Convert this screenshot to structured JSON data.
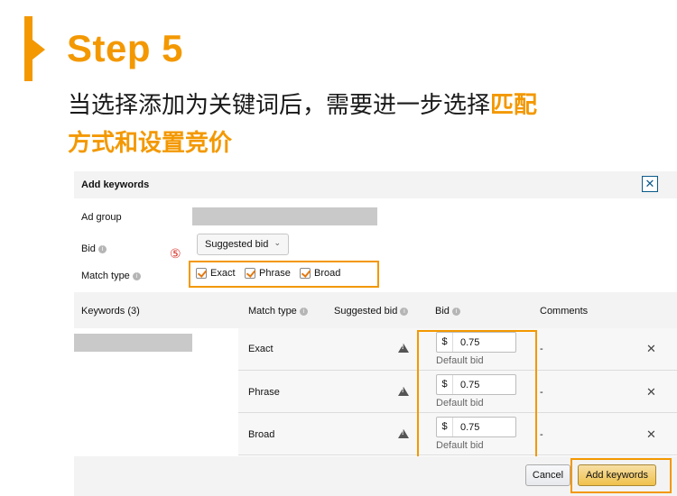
{
  "header": {
    "step_title": "Step 5",
    "desc_line1": "当选择添加为关键词后，需要进一步选择",
    "desc_highlight1": "匹配",
    "desc_highlight2": "方式和设置竞价"
  },
  "dialog": {
    "title": "Add keywords",
    "close_label": "✕",
    "ad_group_label": "Ad group",
    "bid_label": "Bid",
    "bid_select_value": "Suggested bid",
    "match_type_label": "Match type",
    "step_marker": "⑤",
    "match_options": [
      {
        "label": "Exact",
        "checked": true
      },
      {
        "label": "Phrase",
        "checked": true
      },
      {
        "label": "Broad",
        "checked": true
      }
    ],
    "table": {
      "headers": {
        "keywords": "Keywords (3)",
        "match_type": "Match type",
        "suggested_bid": "Suggested bid",
        "bid": "Bid",
        "comments": "Comments"
      },
      "rows": [
        {
          "match_type": "Exact",
          "currency": "$",
          "bid": "0.75",
          "default_bid": "Default bid",
          "comment": "-",
          "remove": "✕"
        },
        {
          "match_type": "Phrase",
          "currency": "$",
          "bid": "0.75",
          "default_bid": "Default bid",
          "comment": "-",
          "remove": "✕"
        },
        {
          "match_type": "Broad",
          "currency": "$",
          "bid": "0.75",
          "default_bid": "Default bid",
          "comment": "-",
          "remove": "✕"
        }
      ]
    },
    "cancel_label": "Cancel",
    "add_label": "Add keywords"
  },
  "colors": {
    "accent": "#f39800",
    "marker": "#d9332b",
    "button_primary": "#f0c14b"
  },
  "icons": {
    "info": "info-icon",
    "warning": "warning-icon",
    "close": "close-icon",
    "chevron": "chevron-down-icon",
    "check": "checkmark-icon"
  }
}
